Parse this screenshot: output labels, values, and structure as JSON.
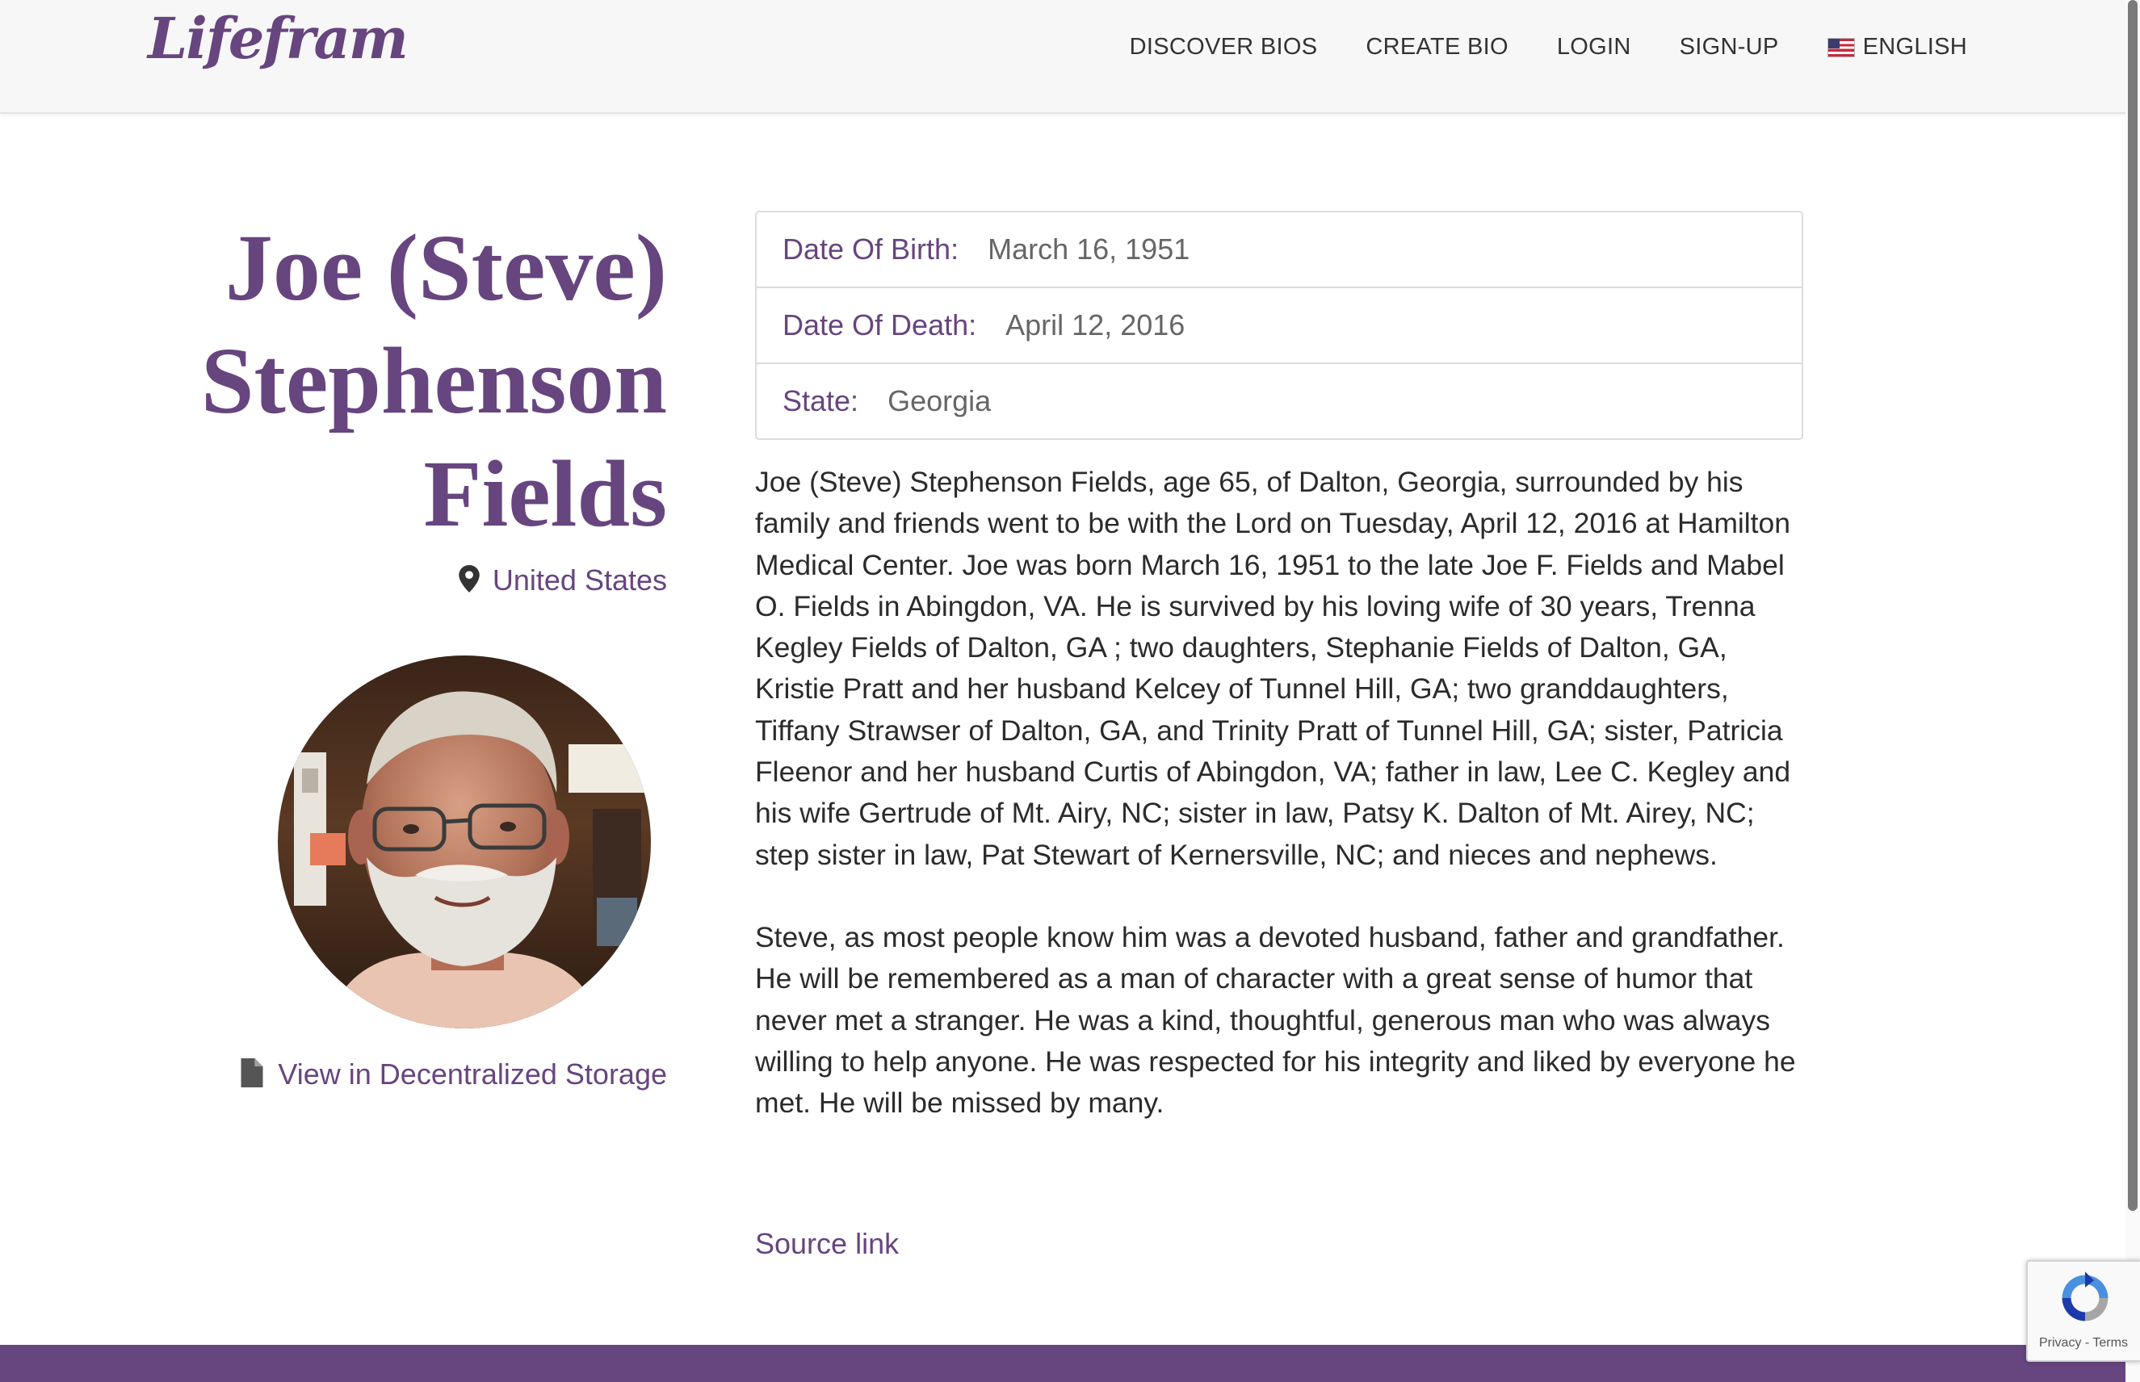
{
  "header": {
    "logo": "Lifefram",
    "nav": [
      {
        "label": "DISCOVER BIOS"
      },
      {
        "label": "CREATE BIO"
      },
      {
        "label": "LOGIN"
      },
      {
        "label": "SIGN-UP"
      }
    ],
    "language": "ENGLISH"
  },
  "profile": {
    "name_lines": [
      "Joe (Steve)",
      "Stephenson",
      "Fields"
    ],
    "location": "United States",
    "storage_link": "View in Decentralized Storage"
  },
  "facts": [
    {
      "label": "Date Of Birth:",
      "value": "March 16, 1951"
    },
    {
      "label": "Date Of Death:",
      "value": "April 12, 2016"
    },
    {
      "label": "State:",
      "value": "Georgia"
    }
  ],
  "bio": {
    "paragraphs": [
      "Joe (Steve) Stephenson Fields, age 65, of Dalton, Georgia, surrounded by his family and friends went to be with the Lord on Tuesday, April 12, 2016 at Hamilton Medical Center. Joe was born March 16, 1951 to the late Joe F. Fields and Mabel O. Fields in Abingdon, VA. He is survived by his loving wife of 30 years, Trenna Kegley Fields of Dalton, GA ; two daughters, Stephanie Fields of Dalton, GA, Kristie Pratt and her husband Kelcey of Tunnel Hill, GA; two granddaughters, Tiffany Strawser of Dalton, GA, and Trinity Pratt of Tunnel Hill, GA; sister, Patricia Fleenor and her husband Curtis of Abingdon, VA; father in law, Lee C. Kegley and his wife Gertrude of Mt. Airy, NC; sister in law, Patsy K. Dalton of Mt. Airey, NC; step sister in law, Pat Stewart of Kernersville, NC; and nieces and nephews.",
      "Steve, as most people know him was a devoted husband, father and grandfather. He will be remembered as a man of character with a great sense of humor that never met a stranger. He was a kind, thoughtful, generous man who was always willing to help anyone. He was respected for his integrity and liked by everyone he met. He will be missed by many."
    ]
  },
  "source_link": "Source link",
  "recaptcha": {
    "privacy": "Privacy",
    "separator": " - ",
    "terms": "Terms"
  },
  "colors": {
    "brand": "#67457f",
    "navbar_bg": "#f7f7f7",
    "footer_bg": "#67457f",
    "text": "#2b2b2b",
    "muted": "#666666"
  },
  "icons": {
    "location": "map-pin-icon",
    "storage": "document-icon",
    "language": "us-flag-icon",
    "recaptcha": "recaptcha-icon"
  }
}
